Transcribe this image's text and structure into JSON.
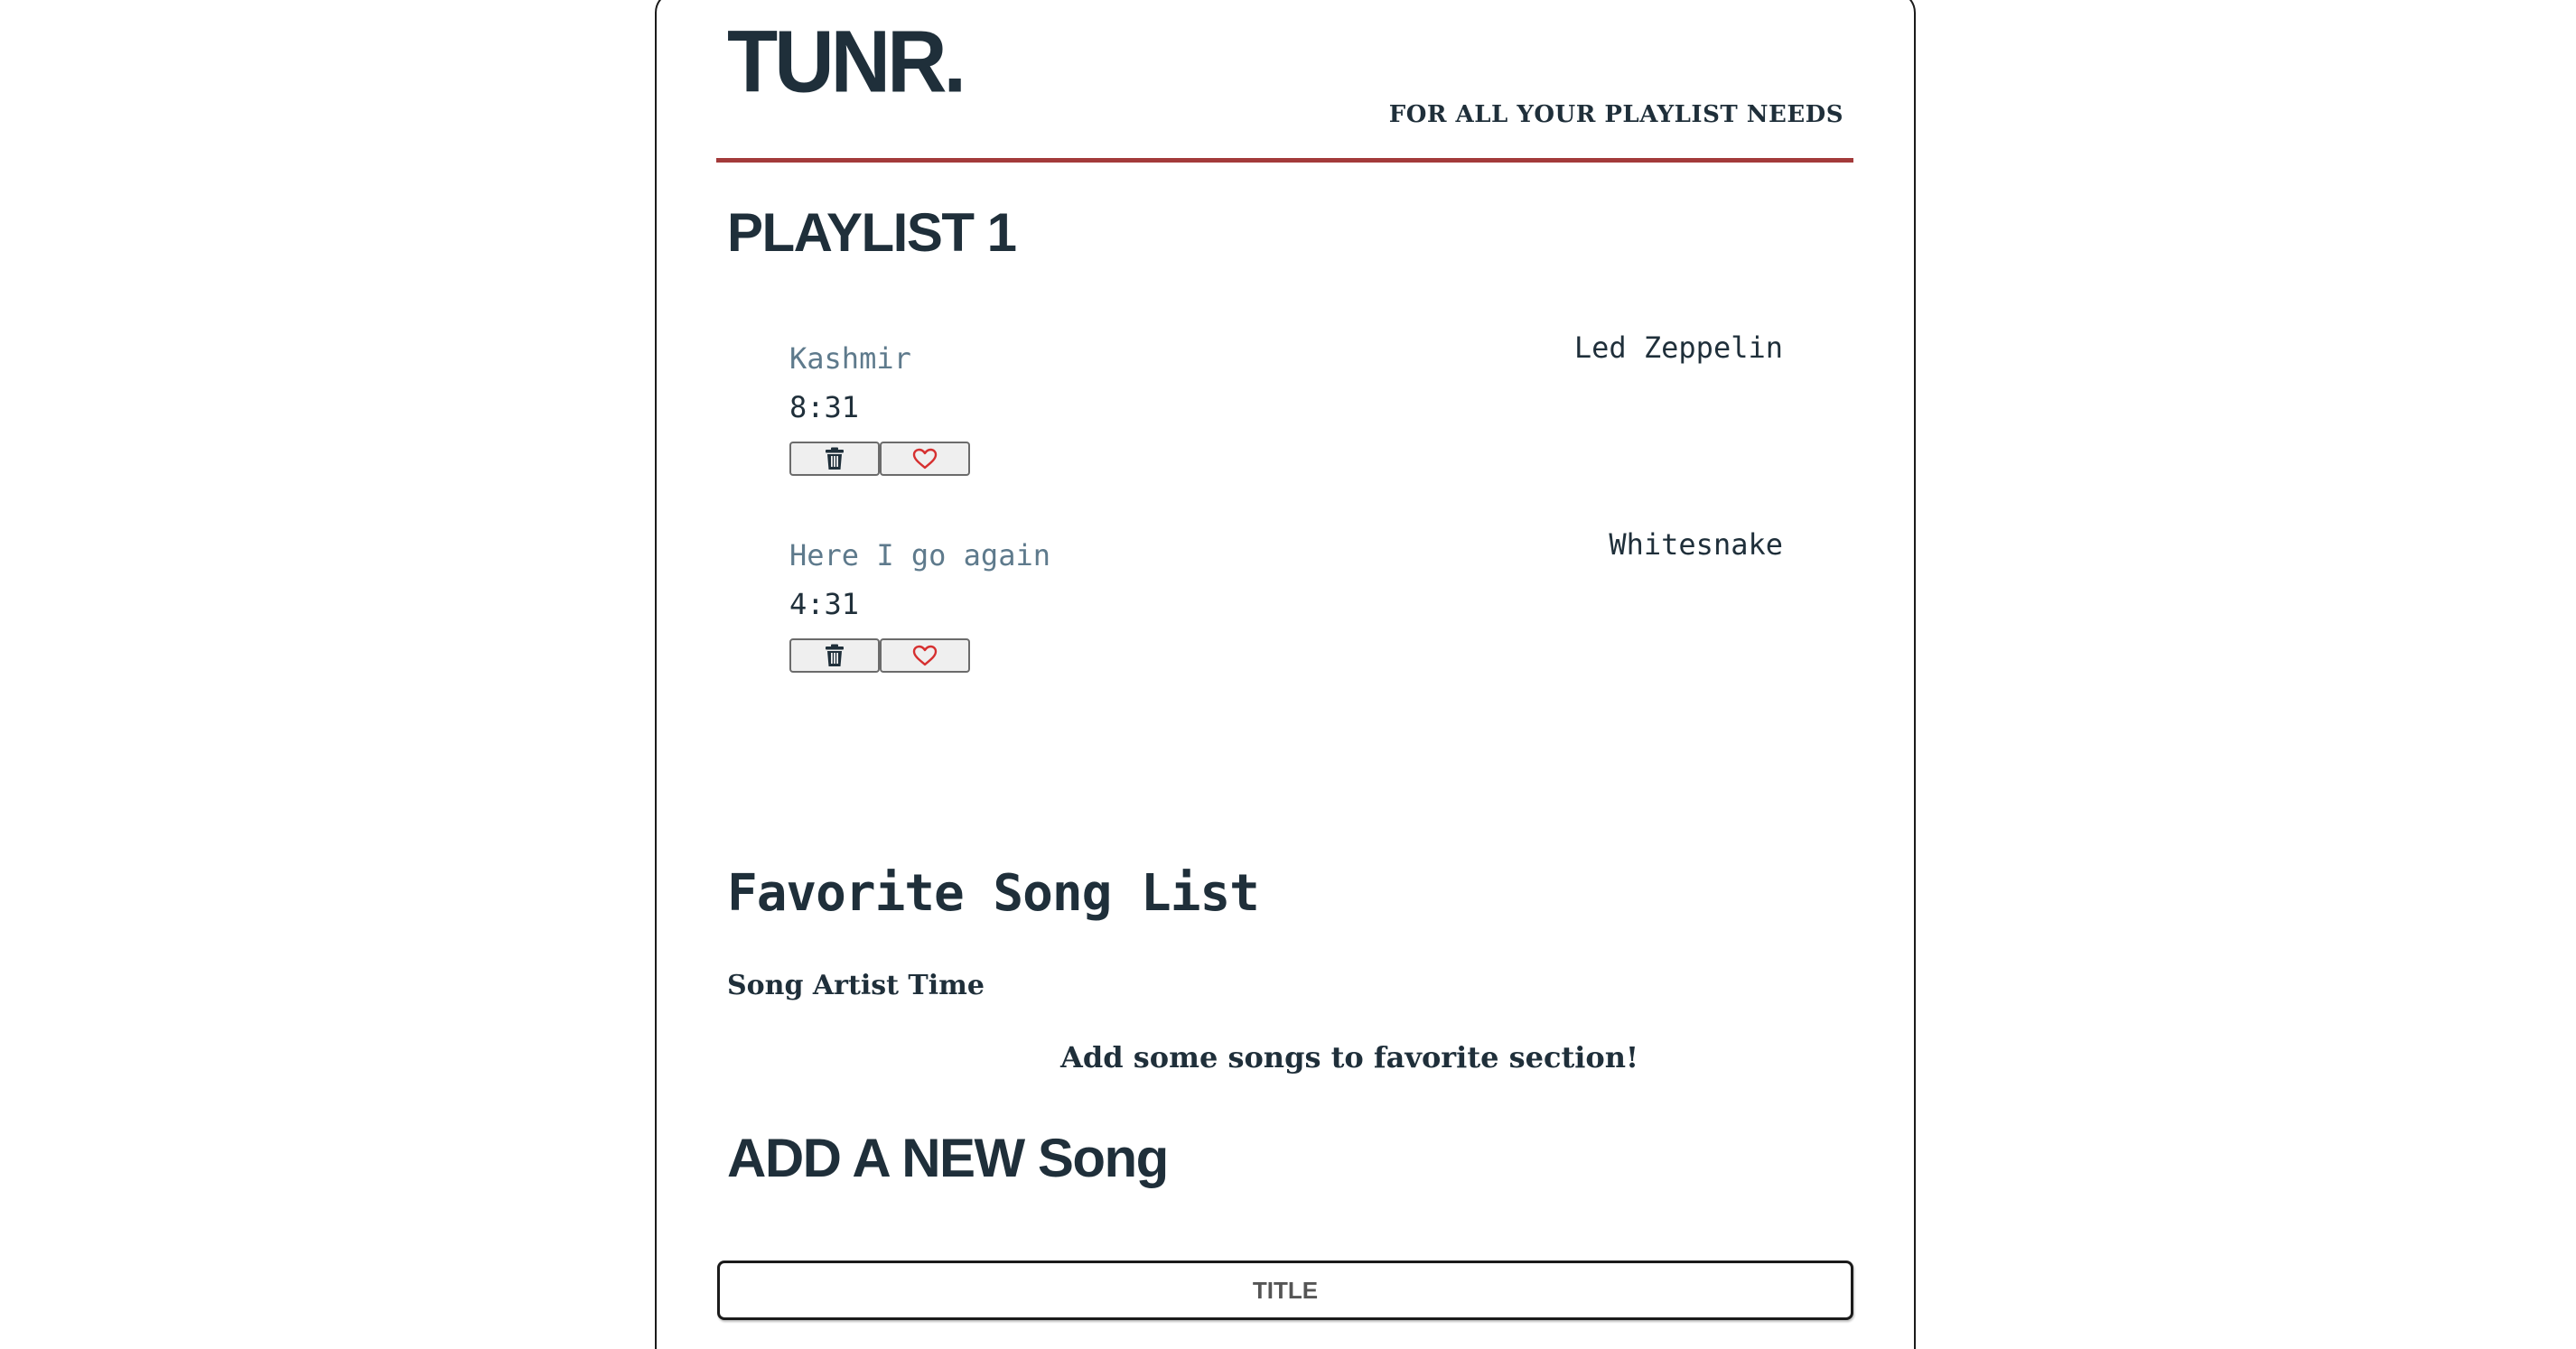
{
  "header": {
    "logo": "TUNR.",
    "tagline": "FOR ALL YOUR PLAYLIST NEEDS"
  },
  "colors": {
    "text": "#1f2f3a",
    "song_title": "#5e7a8c",
    "accent_rule": "#a33a3a",
    "heart": "#d63030"
  },
  "playlist": {
    "title": "PLAYLIST 1",
    "songs": [
      {
        "title": "Kashmir",
        "time": "8:31",
        "artist": "Led Zeppelin",
        "delete_icon": "trash-icon",
        "favorite_icon": "heart-icon"
      },
      {
        "title": "Here I go again",
        "time": "4:31",
        "artist": "Whitesnake",
        "delete_icon": "trash-icon",
        "favorite_icon": "heart-icon"
      }
    ]
  },
  "favorites": {
    "title": "Favorite Song List",
    "header": "Song Artist Time",
    "empty_message": "Add some songs to favorite section!"
  },
  "add_song": {
    "title": "ADD A NEW Song",
    "title_placeholder": "TITLE"
  }
}
